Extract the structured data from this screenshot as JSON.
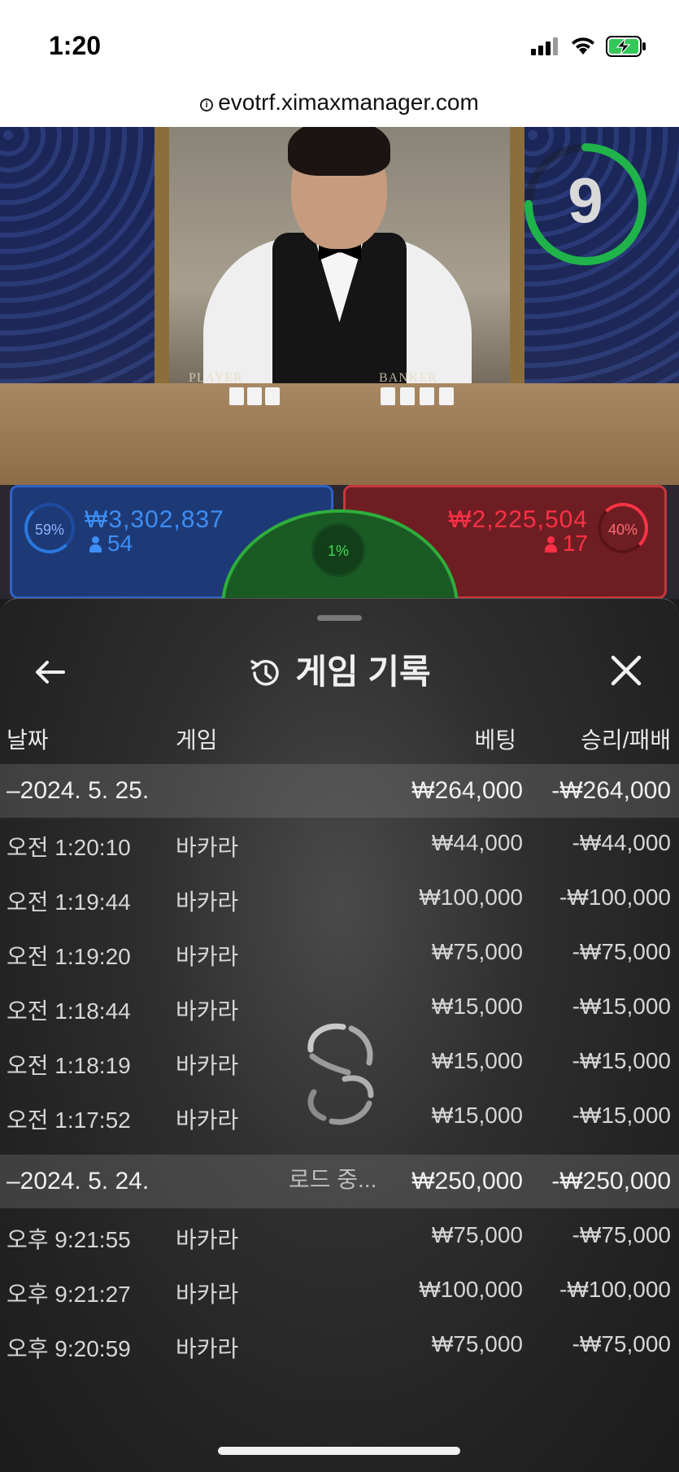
{
  "status_bar": {
    "time": "1:20"
  },
  "browser": {
    "url": "evotrf.ximaxmanager.com"
  },
  "video": {
    "timer": "9",
    "table_labels": [
      "PLAYER",
      "BANKER"
    ]
  },
  "betting": {
    "player": {
      "percent": "59%",
      "amount": "₩3,302,837",
      "players": "54"
    },
    "banker": {
      "percent": "40%",
      "amount": "₩2,225,504",
      "players": "17"
    },
    "tie": {
      "percent": "1%"
    }
  },
  "history": {
    "title": "게임 기록",
    "columns": {
      "date": "날짜",
      "game": "게임",
      "bet": "베팅",
      "win_loss": "승리/패배"
    },
    "groups": [
      {
        "date": "–2024. 5. 25.",
        "bet": "₩264,000",
        "win_loss": "-₩264,000",
        "rows": [
          {
            "time": "오전 1:20:10",
            "game": "바카라",
            "bet": "₩44,000",
            "win_loss": "-₩44,000"
          },
          {
            "time": "오전 1:19:44",
            "game": "바카라",
            "bet": "₩100,000",
            "win_loss": "-₩100,000"
          },
          {
            "time": "오전 1:19:20",
            "game": "바카라",
            "bet": "₩75,000",
            "win_loss": "-₩75,000"
          },
          {
            "time": "오전 1:18:44",
            "game": "바카라",
            "bet": "₩15,000",
            "win_loss": "-₩15,000"
          },
          {
            "time": "오전 1:18:19",
            "game": "바카라",
            "bet": "₩15,000",
            "win_loss": "-₩15,000"
          },
          {
            "time": "오전 1:17:52",
            "game": "바카라",
            "bet": "₩15,000",
            "win_loss": "-₩15,000"
          }
        ]
      },
      {
        "date": "–2024. 5. 24.",
        "bet": "₩250,000",
        "win_loss": "-₩250,000",
        "rows": [
          {
            "time": "오후 9:21:55",
            "game": "바카라",
            "bet": "₩75,000",
            "win_loss": "-₩75,000"
          },
          {
            "time": "오후 9:21:27",
            "game": "바카라",
            "bet": "₩100,000",
            "win_loss": "-₩100,000"
          },
          {
            "time": "오후 9:20:59",
            "game": "바카라",
            "bet": "₩75,000",
            "win_loss": "-₩75,000"
          }
        ]
      }
    ],
    "loading_text": "로드 중..."
  },
  "colors": {
    "player": "#3d8ef5",
    "banker": "#ff3048",
    "tie": "#2eae3c",
    "timer_ring": "#1fb34a"
  },
  "icons": [
    "info-icon",
    "signal-icon",
    "wifi-icon",
    "battery-charging-icon",
    "back-arrow-icon",
    "history-icon",
    "close-icon",
    "loading-spinner-icon",
    "person-icon"
  ]
}
